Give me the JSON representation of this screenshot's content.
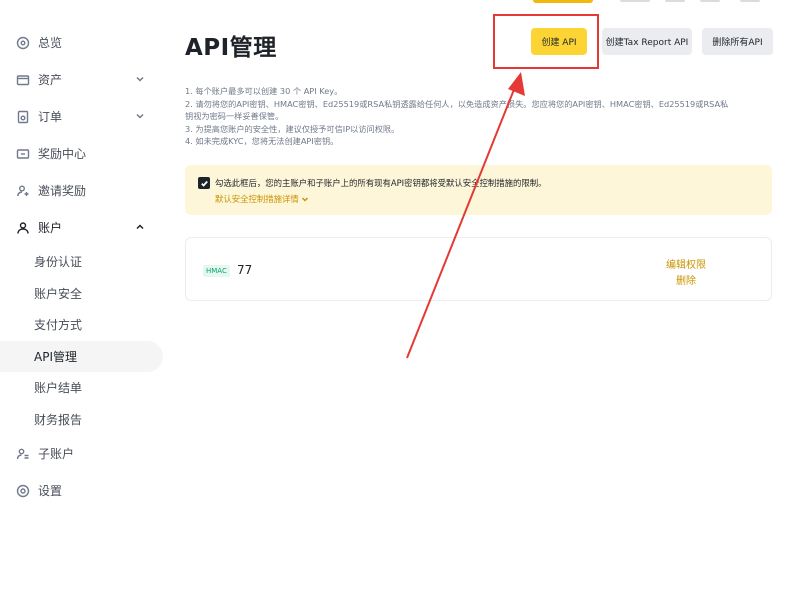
{
  "colors": {
    "accent": "#fcd535",
    "link": "#c99400",
    "annotation": "#e53935",
    "badge_text": "#03a66d"
  },
  "sidebar": {
    "items": [
      {
        "label": "总览",
        "icon": "home-icon"
      },
      {
        "label": "资产",
        "icon": "wallet-icon",
        "expandable": true
      },
      {
        "label": "订单",
        "icon": "order-icon",
        "expandable": true
      },
      {
        "label": "奖励中心",
        "icon": "reward-icon"
      },
      {
        "label": "邀请奖励",
        "icon": "invite-icon"
      },
      {
        "label": "账户",
        "icon": "user-icon",
        "expanded": true
      }
    ],
    "account_sub": [
      {
        "label": "身份认证"
      },
      {
        "label": "账户安全"
      },
      {
        "label": "支付方式"
      },
      {
        "label": "API管理",
        "active": true
      },
      {
        "label": "账户结单"
      },
      {
        "label": "财务报告"
      }
    ],
    "bottom_items": [
      {
        "label": "子账户",
        "icon": "sub-account-icon"
      },
      {
        "label": "设置",
        "icon": "settings-icon"
      }
    ]
  },
  "main": {
    "title": "API管理",
    "buttons": {
      "create_api": "创建 API",
      "create_tax": "创建Tax Report API",
      "delete_all": "删除所有API"
    },
    "notes": [
      "1. 每个账户最多可以创建 30 个 API Key。",
      "2. 请勿将您的API密钥、HMAC密钥、Ed25519或RSA私钥透露给任何人，以免造成资产损失。您应将您的API密钥、HMAC密钥、Ed25519或RSA私",
      "钥视为密码一样妥善保管。",
      "3. 为提高您账户的安全性，建议仅授予可信IP以访问权限。",
      "4. 如未完成KYC，您将无法创建API密钥。"
    ],
    "warning": {
      "text": "勾选此框后，您的主账户和子账户上的所有现有API密钥都将受默认安全控制措施的限制。",
      "link": "默认安全控制措施详情"
    },
    "api_card": {
      "badge": "HMAC",
      "name": "77",
      "edit": "编辑权限",
      "delete": "删除"
    }
  }
}
